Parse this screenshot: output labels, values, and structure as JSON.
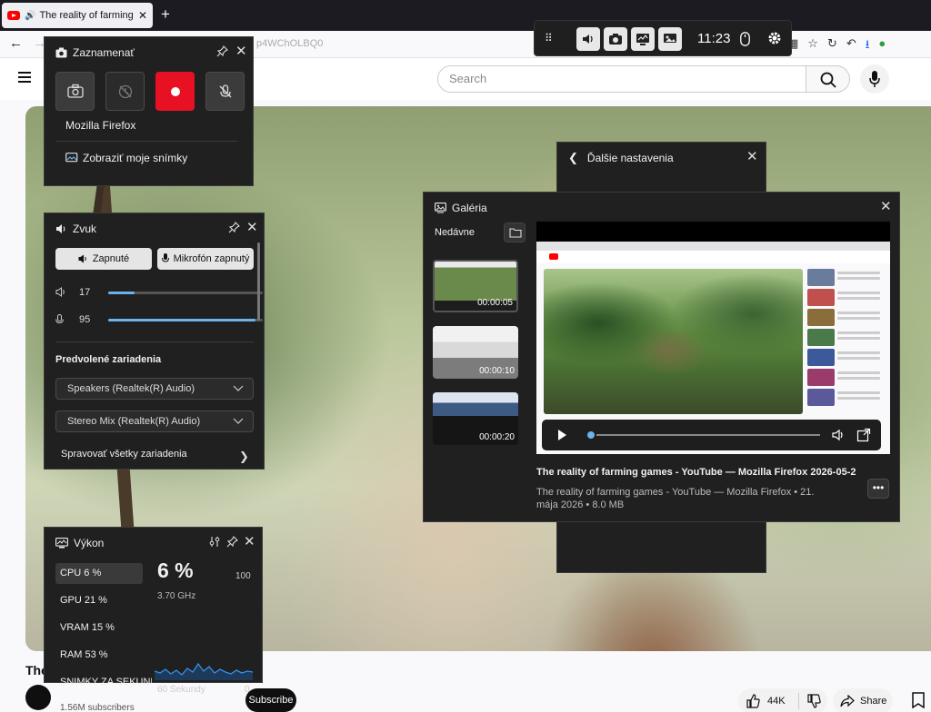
{
  "browser": {
    "tab_title": "The reality of farming games",
    "tab_close": "✕",
    "new_tab": "+",
    "url_fragment": "p4WChOLBQ0",
    "back": "←",
    "forward": "→"
  },
  "youtube": {
    "search_placeholder": "Search",
    "title_fragment": "The",
    "subscribers": "1.56M subscribers",
    "subscribe": "Subscribe",
    "likes": "44K",
    "share": "Share"
  },
  "gamebar": {
    "time": "11:23"
  },
  "capture": {
    "title": "Zaznamenať",
    "app": "Mozilla Firefox",
    "show_captures": "Zobraziť moje snímky"
  },
  "audio": {
    "title": "Zvuk",
    "output_button": "Zapnuté",
    "mic_button": "Mikrofón zapnutý",
    "speaker_value": "17",
    "speaker_level": 0.17,
    "mic_value": "95",
    "mic_level": 0.95,
    "section_title": "Predvolené zariadenia",
    "output_device": "Speakers (Realtek(R) Audio)",
    "input_device": "Stereo Mix (Realtek(R) Audio)",
    "manage": "Spravovať všetky zariadenia"
  },
  "performance": {
    "title": "Výkon",
    "items": [
      {
        "label": "CPU   6 %"
      },
      {
        "label": "GPU   21 %"
      },
      {
        "label": "VRAM   15 %"
      },
      {
        "label": "RAM   53 %"
      },
      {
        "label": "SNIMKY ZA SEKUNDU"
      }
    ],
    "big_value": "6 %",
    "max": "100",
    "frequency": "3.70 GHz",
    "duration": "60 Sekundy",
    "min": "0"
  },
  "more_settings": {
    "title": "Ďalšie nastavenia"
  },
  "gallery": {
    "title": "Galéria",
    "recent": "Nedávne",
    "thumbs": [
      {
        "duration": "00:00:05"
      },
      {
        "duration": "00:00:10"
      },
      {
        "duration": "00:00:20"
      }
    ],
    "item_title": "The reality of farming games - YouTube — Mozilla Firefox 2026-05-2...",
    "item_meta": "The reality of farming games - YouTube — Mozilla Firefox  •  21. mája 2026  •  8.0 MB",
    "more": "•••"
  }
}
